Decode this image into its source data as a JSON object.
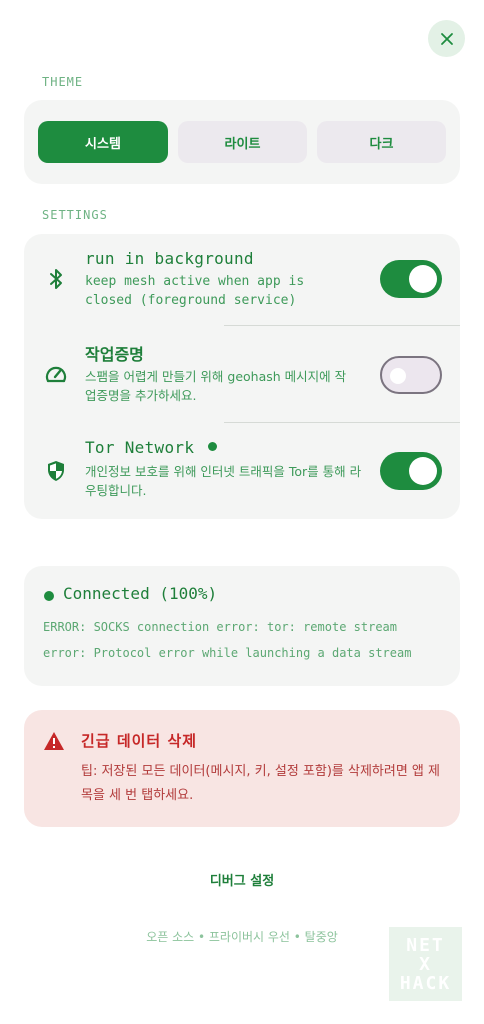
{
  "theme": {
    "section_label": "THEME",
    "options": [
      "시스템",
      "라이트",
      "다크"
    ],
    "selected": "시스템"
  },
  "settings": {
    "section_label": "SETTINGS",
    "items": [
      {
        "title": "run in background",
        "description": "keep mesh active when app is closed (foreground service)",
        "icon": "bluetooth-icon",
        "enabled": true
      },
      {
        "title": "작업증명",
        "description": "스팸을 어렵게 만들기 위해 geohash 메시지에 작업증명을 추가하세요.",
        "icon": "speedometer-icon",
        "enabled": false
      },
      {
        "title": "Tor Network",
        "description": "개인정보 보호를 위해 인터넷 트래픽을 Tor를 통해 라우팅합니다.",
        "icon": "shield-icon",
        "enabled": true,
        "status_dot": true
      }
    ]
  },
  "tor_status": {
    "text": "Connected (100%)",
    "errors": [
      "ERROR: SOCKS connection error: tor: remote stream",
      "error: Protocol error while launching a data stream"
    ]
  },
  "panic": {
    "title": "긴급 데이터 삭제",
    "description": "팁: 저장된 모든 데이터(메시지, 키, 설정 포함)를 삭제하려면 앱 제목을 세 번 탭하세요."
  },
  "debug_link": "디버그 설정",
  "footer": "오픈 소스 • 프라이버시 우선 • 탈중앙",
  "watermark": [
    "NET",
    "X",
    "HACK"
  ],
  "colors": {
    "accent": "#1e8c3f",
    "danger": "#c62828",
    "card": "#f4f5f4"
  }
}
